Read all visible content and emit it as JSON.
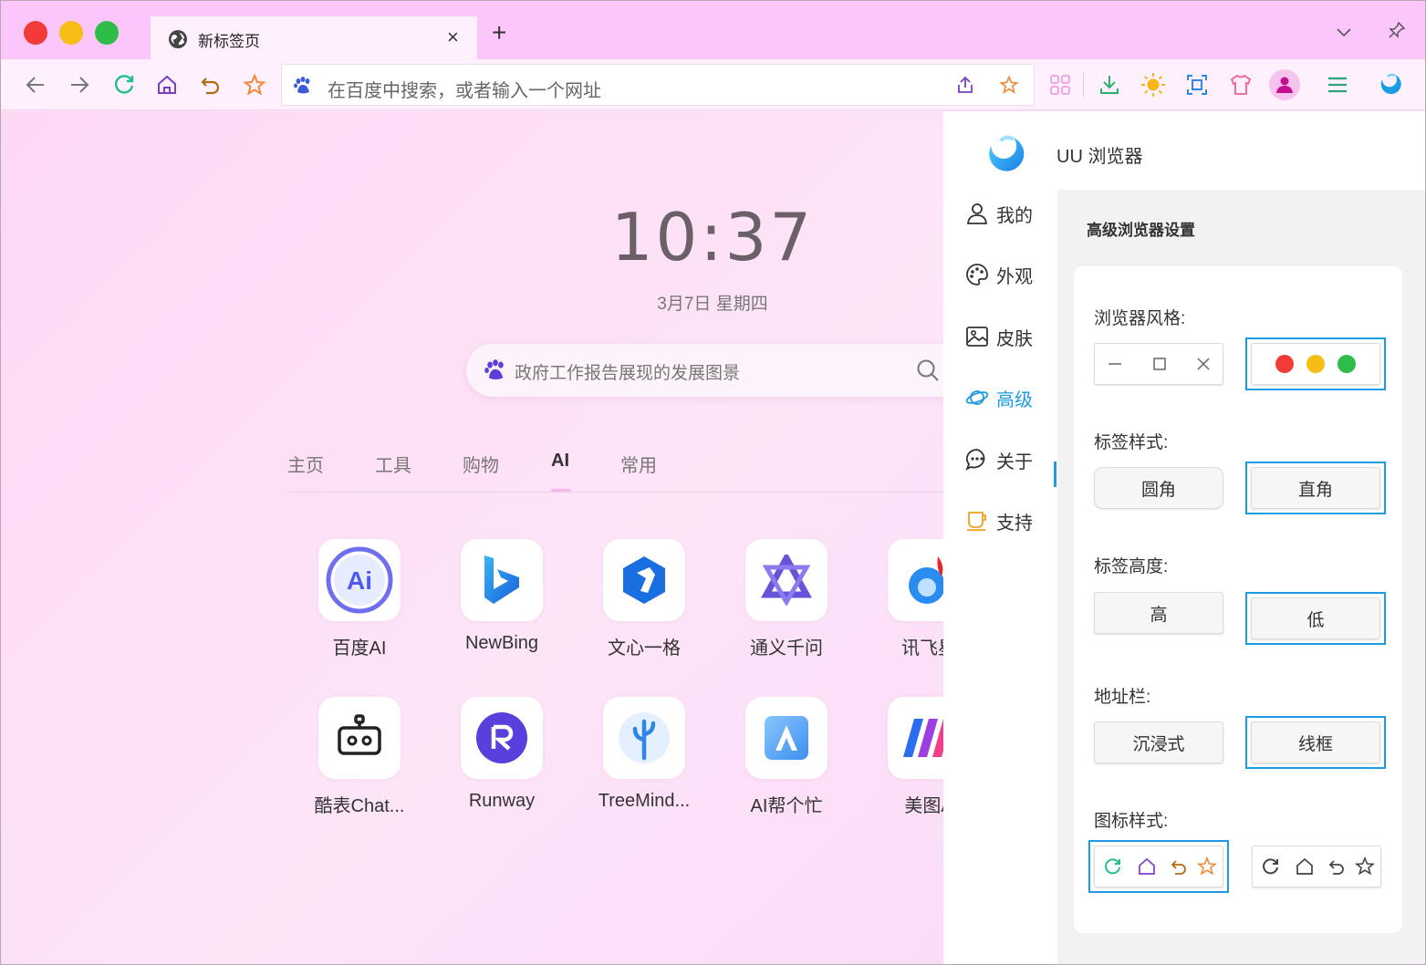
{
  "titlebar": {
    "tab_title": "新标签页",
    "tab_close": "×",
    "new_tab": "+"
  },
  "toolbar": {
    "address_placeholder": "在百度中搜索，或者输入一个网址"
  },
  "newtab": {
    "time": "10:37",
    "date": "3月7日 星期四",
    "search_placeholder": "政府工作报告展现的发展图景",
    "categories": [
      "主页",
      "工具",
      "购物",
      "AI",
      "常用"
    ],
    "active_category": "AI",
    "apps": [
      {
        "label": "百度AI",
        "icon": "baidu-ai-icon"
      },
      {
        "label": "NewBing",
        "icon": "bing-icon"
      },
      {
        "label": "文心一格",
        "icon": "wenxin-yige-icon"
      },
      {
        "label": "通义千问",
        "icon": "tongyi-icon"
      },
      {
        "label": "讯飞星",
        "icon": "xunfei-icon"
      },
      {
        "label": "酷表Chat...",
        "icon": "robot-icon"
      },
      {
        "label": "Runway",
        "icon": "runway-icon"
      },
      {
        "label": "TreeMind...",
        "icon": "treemind-icon"
      },
      {
        "label": "AI帮个忙",
        "icon": "ai-help-icon"
      },
      {
        "label": "美图A",
        "icon": "meitu-icon"
      }
    ]
  },
  "panel": {
    "app_name": "UU 浏览器",
    "nav": [
      {
        "label": "我的",
        "icon": "user-icon"
      },
      {
        "label": "外观",
        "icon": "palette-icon"
      },
      {
        "label": "皮肤",
        "icon": "image-icon"
      },
      {
        "label": "高级",
        "icon": "planet-icon"
      },
      {
        "label": "关于",
        "icon": "chat-icon"
      },
      {
        "label": "支持",
        "icon": "coffee-icon"
      }
    ],
    "active_nav": "高级",
    "section_title": "高级浏览器设置",
    "settings": {
      "browser_style": {
        "label": "浏览器风格:",
        "options": [
          "windows",
          "mac"
        ],
        "selected": "mac"
      },
      "tab_style": {
        "label": "标签样式:",
        "options": [
          "圆角",
          "直角"
        ],
        "selected": "直角"
      },
      "tab_height": {
        "label": "标签高度:",
        "options": [
          "高",
          "低"
        ],
        "selected": "低"
      },
      "address_bar": {
        "label": "地址栏:",
        "options": [
          "沉浸式",
          "线框"
        ],
        "selected": "线框"
      },
      "icon_style": {
        "label": "图标样式:",
        "options": [
          "colored",
          "mono"
        ],
        "selected": "colored"
      }
    }
  },
  "colors": {
    "titlebar": "#fdc6fa",
    "accent": "#1a9de6",
    "close_red": "#f23b36",
    "min_yellow": "#f7bd17",
    "max_green": "#2ebd48"
  }
}
